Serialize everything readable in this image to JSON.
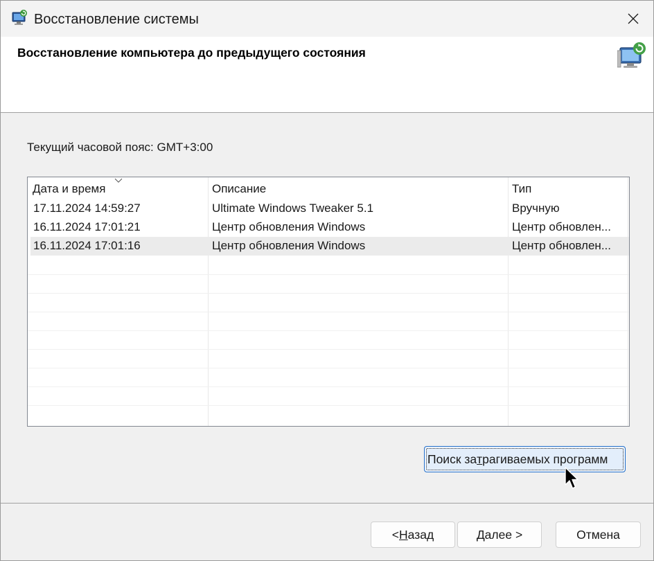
{
  "window": {
    "title": "Восстановление системы",
    "title_icon": "system-restore-icon"
  },
  "header": {
    "title": "Восстановление компьютера до предыдущего состояния",
    "icon": "system-restore-monitor-icon"
  },
  "timezone": {
    "text": "Текущий часовой пояс: GMT+3:00"
  },
  "restore_points": {
    "columns": [
      "Дата и время",
      "Описание",
      "Тип"
    ],
    "sorted_column": "Дата и время",
    "rows": [
      {
        "date": "17.11.2024 14:59:27",
        "description": "Ultimate Windows Tweaker 5.1",
        "type": "Вручную"
      },
      {
        "date": "16.11.2024 17:01:21",
        "description": "Центр обновления Windows",
        "type": "Центр обновлен..."
      },
      {
        "date": "16.11.2024 17:01:16",
        "description": "Центр обновления Windows",
        "type": "Центр обновлен..."
      }
    ],
    "selected_row": 2
  },
  "buttons": {
    "scan_pre": "Поиск за",
    "scan_u": "т",
    "scan_post": "рагиваемых программ",
    "back_pre": "< ",
    "back_u": "Н",
    "back_post": "азад",
    "next_pre": "",
    "next_u": "Д",
    "next_post": "алее >",
    "cancel": "Отмена"
  },
  "colors": {
    "accent": "#1b6ac9",
    "scan_button_bg": "#e3eefb",
    "selected_row_bg": "#ebebeb"
  }
}
